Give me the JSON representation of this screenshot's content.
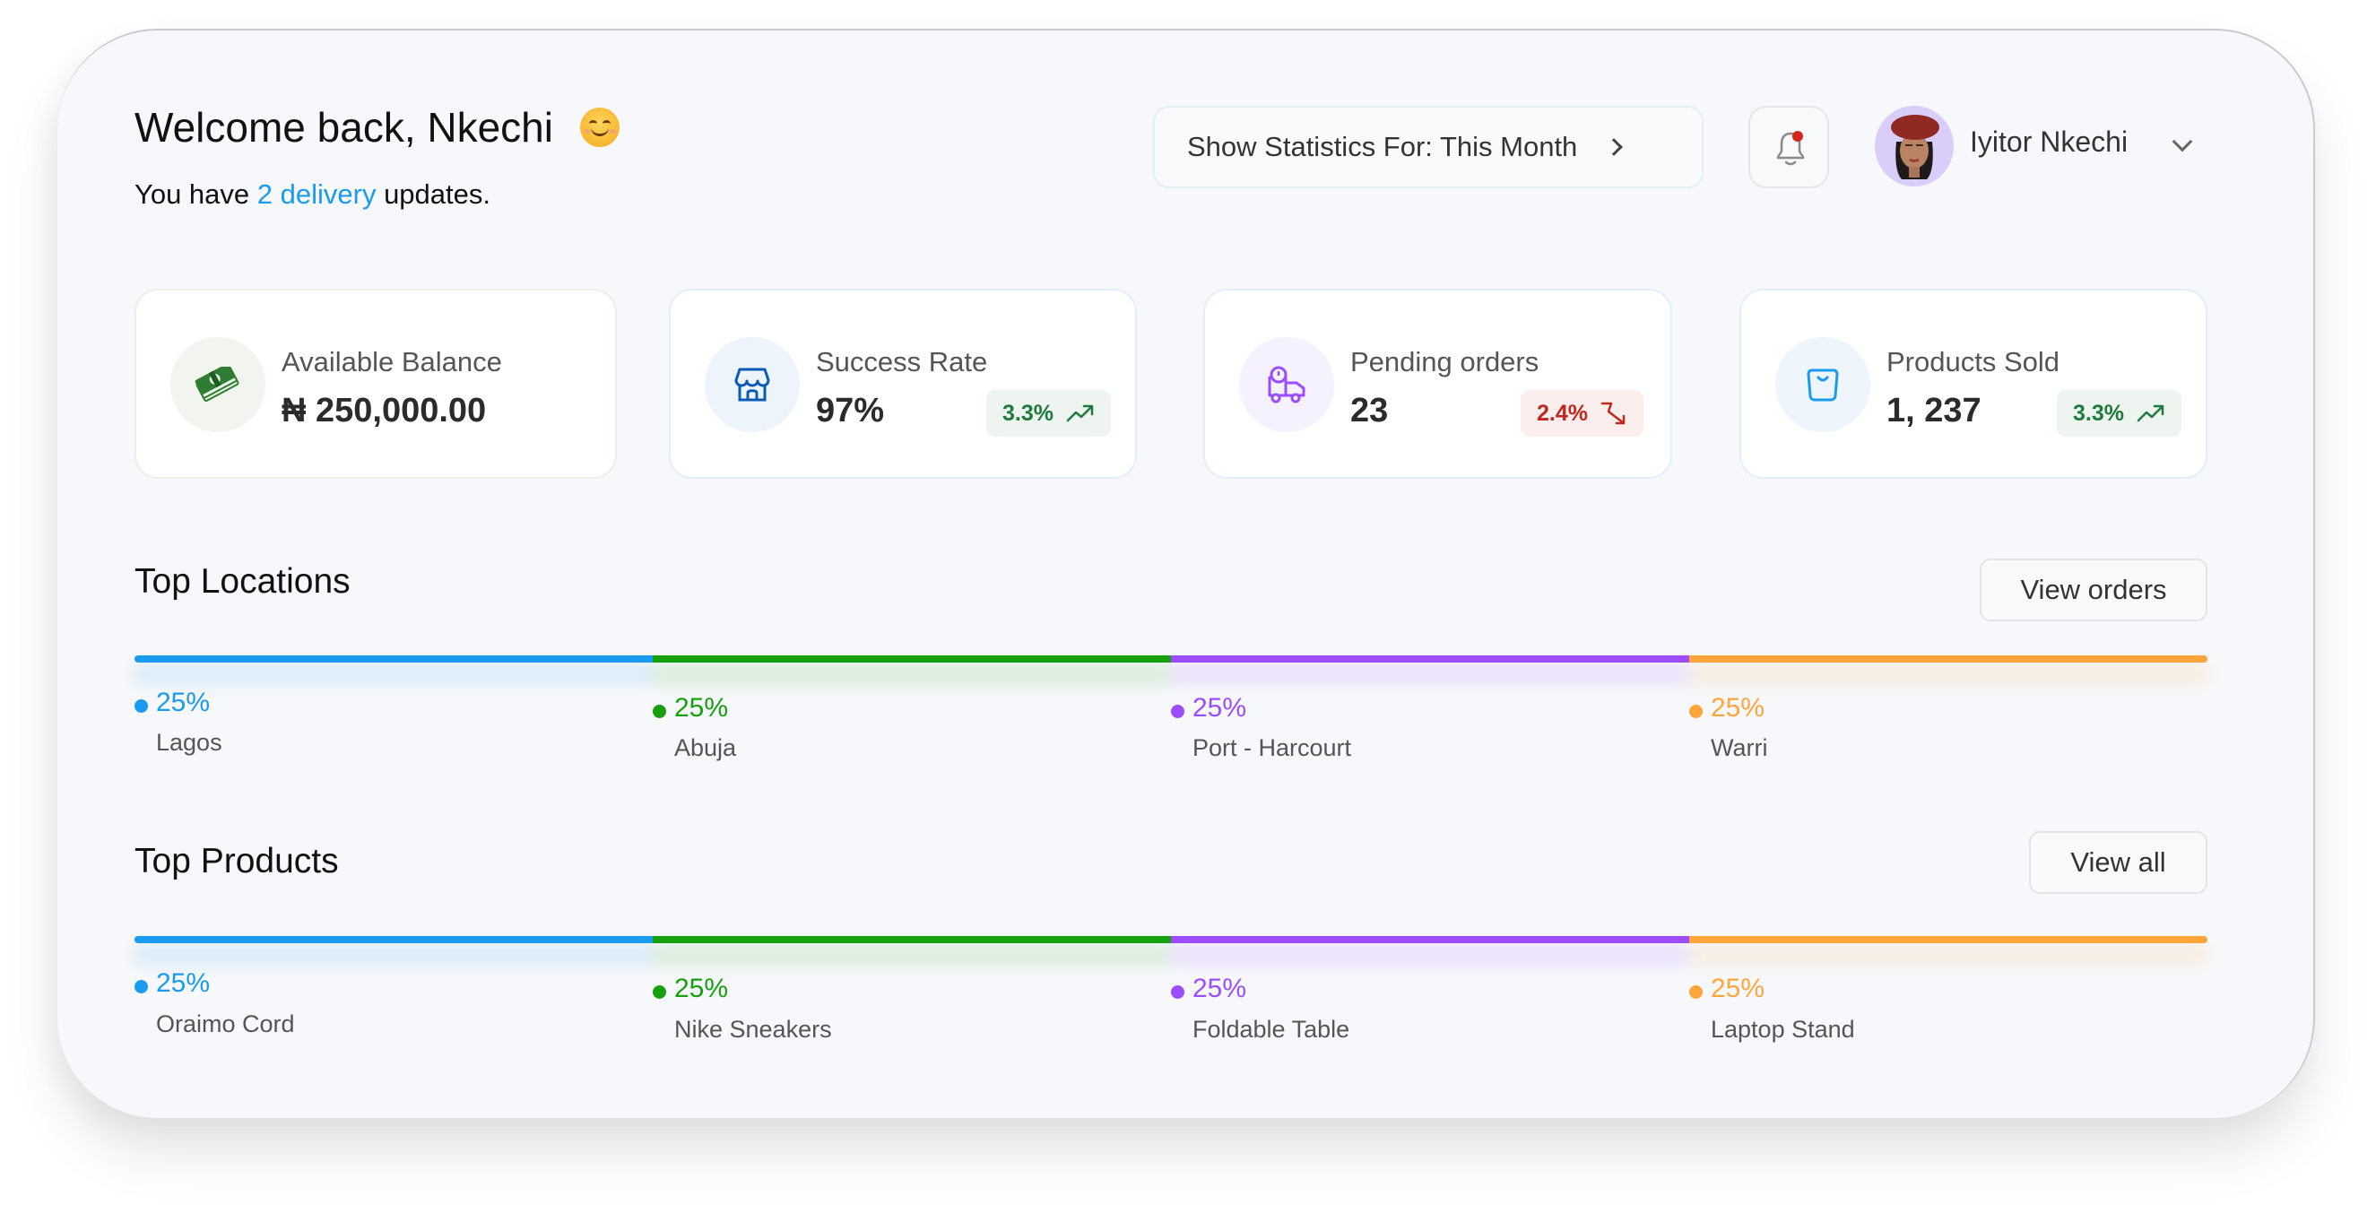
{
  "header": {
    "welcome": "Welcome back, Nkechi",
    "emoji": "smiling-face",
    "subtitle_prefix": "You have ",
    "subtitle_link": "2 delivery",
    "subtitle_suffix": " updates.",
    "stats_button": "Show Statistics For: This Month",
    "notification_dot_color": "#d0291c",
    "user_name": "Iyitor Nkechi"
  },
  "cards": [
    {
      "label": "Available Balance",
      "value": "₦ 250,000.00",
      "icon": "money-stack-icon",
      "color": "#2e7d32",
      "bg": "#f1f4ef"
    },
    {
      "label": "Success Rate",
      "value": "97%",
      "icon": "storefront-icon",
      "color": "#0b5bb5",
      "bg": "#eef4fb",
      "change": "3.3%",
      "trend": "up"
    },
    {
      "label": "Pending orders",
      "value": "23",
      "icon": "delivery-truck-icon",
      "color": "#9b4dff",
      "bg": "#f6f1fe",
      "change": "2.4%",
      "trend": "down"
    },
    {
      "label": "Products Sold",
      "value": "1, 237",
      "icon": "shopping-bag-icon",
      "color": "#1a9bf0",
      "bg": "#eef5fc",
      "change": "3.3%",
      "trend": "up"
    }
  ],
  "colors": {
    "blue": "#1a9bf0",
    "green": "#17a00e",
    "purple": "#9b4dff",
    "orange": "#ffa53c",
    "up": "#1f7a3e",
    "down": "#c0271d"
  },
  "locations": {
    "title": "Top Locations",
    "button": "View orders",
    "items": [
      {
        "name": "Lagos",
        "percent": 25,
        "label": "25%",
        "color": "#1a9bf0"
      },
      {
        "name": "Abuja",
        "percent": 25,
        "label": "25%",
        "color": "#17a00e"
      },
      {
        "name": "Port - Harcourt",
        "percent": 25,
        "label": "25%",
        "color": "#9b4dff"
      },
      {
        "name": "Warri",
        "percent": 25,
        "label": "25%",
        "color": "#ffa53c"
      }
    ]
  },
  "products": {
    "title": "Top Products",
    "button": "View all",
    "items": [
      {
        "name": "Oraimo Cord",
        "percent": 25,
        "label": "25%",
        "color": "#1a9bf0"
      },
      {
        "name": "Nike Sneakers",
        "percent": 25,
        "label": "25%",
        "color": "#17a00e"
      },
      {
        "name": "Foldable Table",
        "percent": 25,
        "label": "25%",
        "color": "#9b4dff"
      },
      {
        "name": "Laptop Stand",
        "percent": 25,
        "label": "25%",
        "color": "#ffa53c"
      }
    ]
  }
}
